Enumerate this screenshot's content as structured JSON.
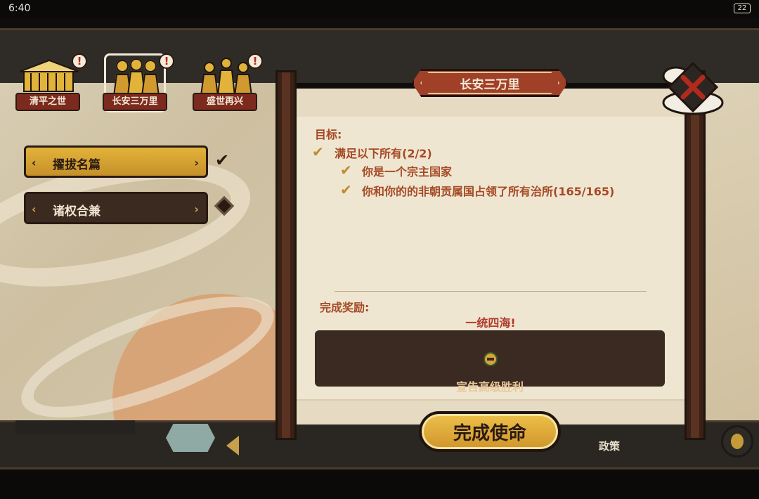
{
  "status_bar": {
    "time": "6:40",
    "battery": "22"
  },
  "tabs": [
    {
      "label": "清平之世",
      "alert": "!"
    },
    {
      "label": "长安三万里",
      "alert": "!"
    },
    {
      "label": "盛世再兴",
      "alert": "!"
    }
  ],
  "missions": [
    {
      "label": "擢拔名篇",
      "state": "completed"
    },
    {
      "label": "诸权合兼",
      "state": "pending"
    }
  ],
  "dialog": {
    "title": "长安三万里",
    "objective_label": "目标:",
    "objectives": [
      {
        "text": "满足以下所有(2/2)"
      },
      {
        "text": "你是一个宗主国家"
      },
      {
        "text": "你和你的的非朝贡属国占领了所有治所(165/165)"
      }
    ],
    "reward_label": "完成奖励:",
    "reward_title": "一统四海!",
    "reward_text": "宣告高级胜利",
    "complete_button": "完成使命"
  },
  "bottom_hud": {
    "policy_label": "政策"
  },
  "colors": {
    "banner": "#a14028",
    "objective_text": "#a54a25",
    "check": "#c08b2e",
    "reward_title": "#b03a2b",
    "button": "#e2b33a"
  }
}
